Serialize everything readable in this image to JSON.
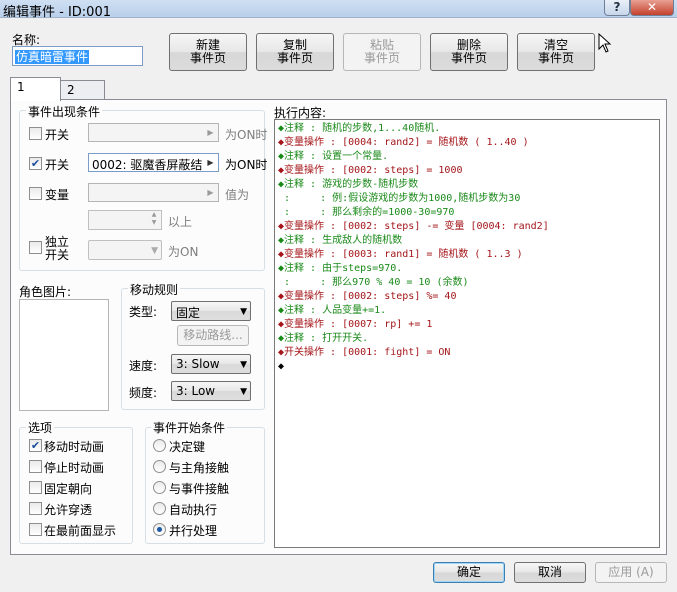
{
  "window": {
    "title": "编辑事件 - ID:001",
    "help_label": "?",
    "close_label": "✕"
  },
  "name_label": "名称:",
  "name_value": "仿真暗雷事件",
  "toolbar": {
    "new_page": [
      "新建",
      "事件页"
    ],
    "copy_page": [
      "复制",
      "事件页"
    ],
    "paste_page": [
      "粘贴",
      "事件页"
    ],
    "delete_page": [
      "删除",
      "事件页"
    ],
    "clear_page": [
      "清空",
      "事件页"
    ]
  },
  "tabs": [
    {
      "label": "1"
    },
    {
      "label": "2"
    }
  ],
  "conditions": {
    "title": "事件出现条件",
    "switch1": {
      "label": "开关",
      "checked": false,
      "value": "",
      "suffix": "为ON时"
    },
    "switch2": {
      "label": "开关",
      "checked": true,
      "value": "0002: 驱魔香屏蔽结",
      "suffix": "为ON时"
    },
    "variable": {
      "label": "变量",
      "checked": false,
      "value": "",
      "suffix": "值为",
      "ge_suffix": "以上"
    },
    "self_switch": {
      "label_line1": "独立",
      "label_line2": "开关",
      "checked": false,
      "suffix": "为ON"
    }
  },
  "graphic": {
    "title": "角色图片:"
  },
  "movement": {
    "title": "移动规则",
    "type_label": "类型:",
    "type_value": "固定",
    "route_button": "移动路线...",
    "speed_label": "速度:",
    "speed_value": "3: Slow",
    "freq_label": "频度:",
    "freq_value": "3: Low"
  },
  "options": {
    "title": "选项",
    "items": [
      {
        "label": "移动时动画",
        "checked": true
      },
      {
        "label": "停止时动画",
        "checked": false
      },
      {
        "label": "固定朝向",
        "checked": false
      },
      {
        "label": "允许穿透",
        "checked": false
      },
      {
        "label": "在最前面显示",
        "checked": false
      }
    ]
  },
  "trigger": {
    "title": "事件开始条件",
    "items": [
      {
        "label": "决定键",
        "selected": false
      },
      {
        "label": "与主角接触",
        "selected": false
      },
      {
        "label": "与事件接触",
        "selected": false
      },
      {
        "label": "自动执行",
        "selected": false
      },
      {
        "label": "并行处理",
        "selected": true
      }
    ]
  },
  "commands": {
    "title": "执行内容:",
    "lines": [
      {
        "text": "◆注释 : 随机的步数,1...40随机.",
        "kind": "comment"
      },
      {
        "text": "◆变量操作 : [0004: rand2] = 随机数 ( 1..40 )",
        "kind": "var"
      },
      {
        "text": "◆注释 : 设置一个常量.",
        "kind": "comment"
      },
      {
        "text": "◆变量操作 : [0002: steps] = 1000",
        "kind": "var"
      },
      {
        "text": "◆注释 : 游戏的步数-随机步数",
        "kind": "comment"
      },
      {
        "text": " :     : 例:假设游戏的步数为1000,随机步数为30",
        "kind": "comment"
      },
      {
        "text": " :     : 那么剩余的=1000-30=970",
        "kind": "comment"
      },
      {
        "text": "◆变量操作 : [0002: steps] -= 变量 [0004: rand2]",
        "kind": "var"
      },
      {
        "text": "◆注释 : 生成敌人的随机数",
        "kind": "comment"
      },
      {
        "text": "◆变量操作 : [0003: rand1] = 随机数 ( 1..3 )",
        "kind": "var"
      },
      {
        "text": "◆注释 : 由于steps=970.",
        "kind": "comment"
      },
      {
        "text": " :     : 那么970 % 40 = 10 (余数)",
        "kind": "comment"
      },
      {
        "text": "◆变量操作 : [0002: steps] %= 40",
        "kind": "var"
      },
      {
        "text": "◆注释 : 人品变量+=1.",
        "kind": "comment"
      },
      {
        "text": "◆变量操作 : [0007: rp] += 1",
        "kind": "var"
      },
      {
        "text": "◆注释 : 打开开关.",
        "kind": "comment"
      },
      {
        "text": "◆开关操作 : [0001: fight] = ON",
        "kind": "var"
      },
      {
        "text": "◆",
        "kind": "plain"
      }
    ]
  },
  "footer": {
    "ok": "确定",
    "cancel": "取消",
    "apply": "应用 (A)"
  },
  "colors": {
    "comment": "#1a8a1a",
    "variable": "#a4161a",
    "selection": "#3399ff"
  }
}
